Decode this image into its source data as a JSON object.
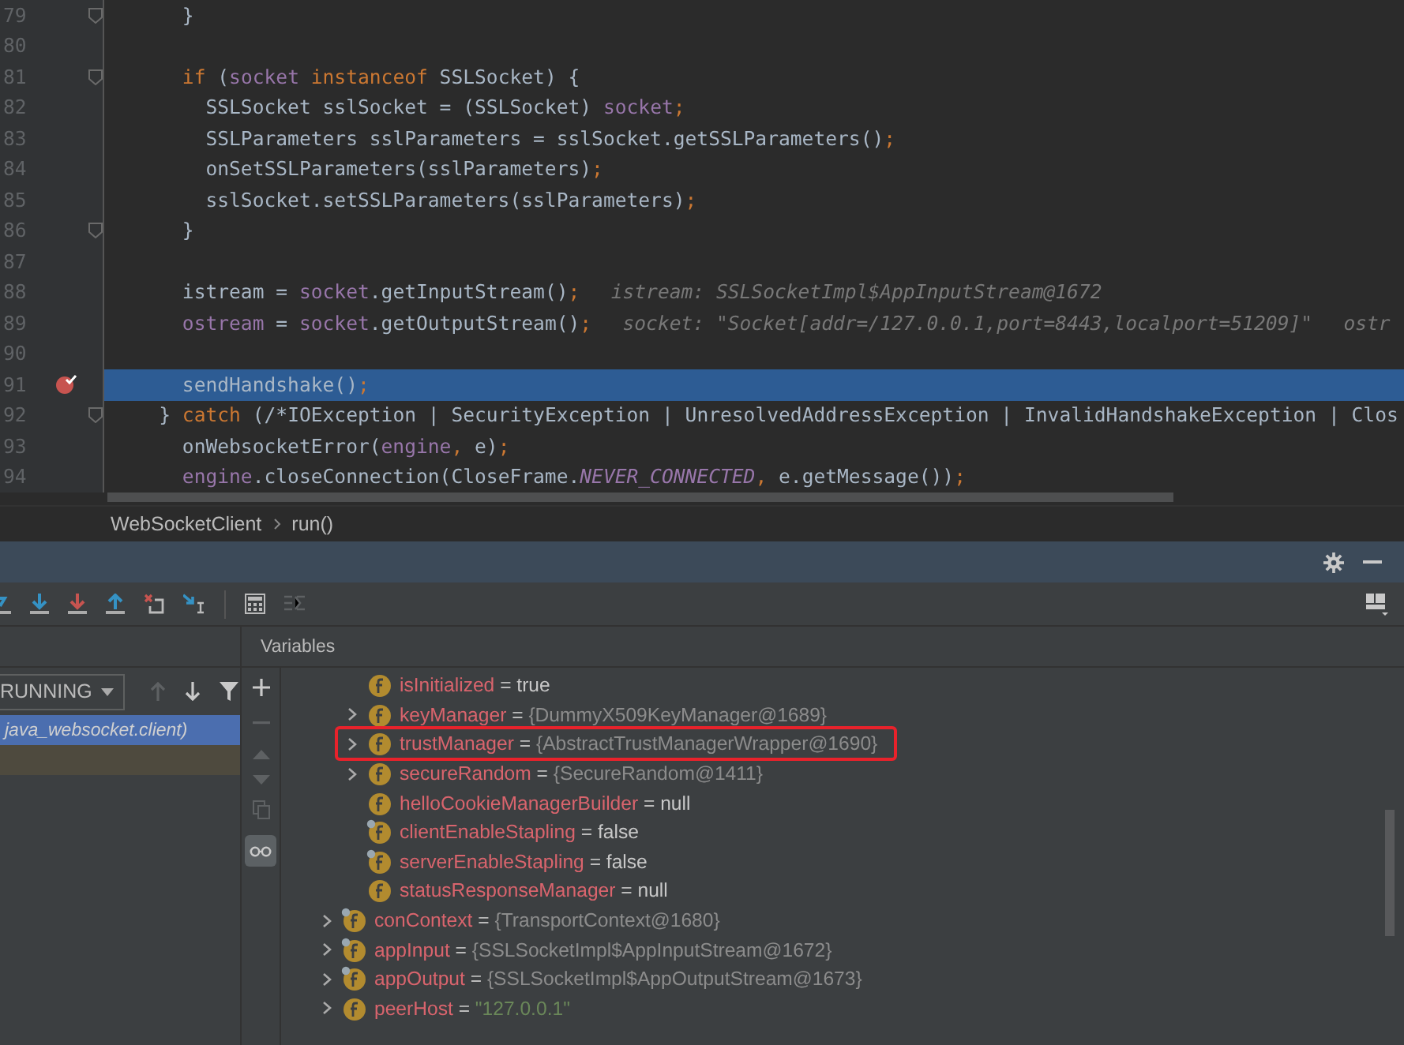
{
  "editor": {
    "lines": [
      {
        "number": "79",
        "fold": true,
        "breakpoint": false,
        "current": false,
        "segments": [
          {
            "kind": "plain",
            "text": "      }"
          }
        ]
      },
      {
        "number": "80",
        "fold": false,
        "breakpoint": false,
        "current": false
      },
      {
        "number": "81",
        "fold": true,
        "breakpoint": false,
        "current": false,
        "segments": [
          {
            "kind": "keyword",
            "text": "      if"
          },
          {
            "kind": "plain",
            "text": " ("
          },
          {
            "kind": "field",
            "text": "socket"
          },
          {
            "kind": "keyword",
            "text": " instanceof"
          },
          {
            "kind": "plain",
            "text": " SSLSocket) {"
          }
        ]
      },
      {
        "number": "82",
        "fold": false,
        "breakpoint": false,
        "current": false,
        "segments": [
          {
            "kind": "plain",
            "text": "        SSLSocket sslSocket = (SSLSocket) "
          },
          {
            "kind": "field",
            "text": "socket"
          },
          {
            "kind": "keyword",
            "text": ";"
          }
        ]
      },
      {
        "number": "83",
        "fold": false,
        "breakpoint": false,
        "current": false,
        "segments": [
          {
            "kind": "plain",
            "text": "        SSLParameters sslParameters = sslSocket.getSSLParameters()"
          },
          {
            "kind": "keyword",
            "text": ";"
          }
        ]
      },
      {
        "number": "84",
        "fold": false,
        "breakpoint": false,
        "current": false,
        "segments": [
          {
            "kind": "plain",
            "text": "        onSetSSLParameters(sslParameters)"
          },
          {
            "kind": "keyword",
            "text": ";"
          }
        ]
      },
      {
        "number": "85",
        "fold": false,
        "breakpoint": false,
        "current": false,
        "segments": [
          {
            "kind": "plain",
            "text": "        sslSocket.setSSLParameters(sslParameters)"
          },
          {
            "kind": "keyword",
            "text": ";"
          }
        ]
      },
      {
        "number": "86",
        "fold": true,
        "breakpoint": false,
        "current": false,
        "segments": [
          {
            "kind": "plain",
            "text": "      }"
          }
        ]
      },
      {
        "number": "87",
        "fold": false,
        "breakpoint": false,
        "current": false
      },
      {
        "number": "88",
        "fold": false,
        "breakpoint": false,
        "current": false,
        "segments": [
          {
            "kind": "plain",
            "text": "      istream = "
          },
          {
            "kind": "field",
            "text": "socket"
          },
          {
            "kind": "plain",
            "text": ".getInputStream()"
          },
          {
            "kind": "keyword",
            "text": ";"
          },
          {
            "kind": "hint",
            "text": "istream: SSLSocketImpl$AppInputStream@1672"
          }
        ]
      },
      {
        "number": "89",
        "fold": false,
        "breakpoint": false,
        "current": false,
        "segments": [
          {
            "kind": "field",
            "text": "      ostream"
          },
          {
            "kind": "plain",
            "text": " = "
          },
          {
            "kind": "field",
            "text": "socket"
          },
          {
            "kind": "plain",
            "text": ".getOutputStream()"
          },
          {
            "kind": "keyword",
            "text": ";"
          },
          {
            "kind": "hint",
            "text": "socket: \"Socket[addr=/127.0.0.1,port=8443,localport=51209]\""
          },
          {
            "kind": "hint",
            "text": "ostr"
          }
        ]
      },
      {
        "number": "90",
        "fold": false,
        "breakpoint": false,
        "current": false
      },
      {
        "number": "91",
        "fold": false,
        "breakpoint": true,
        "current": true,
        "segments": [
          {
            "kind": "plain",
            "text": "      sendHandshake()"
          },
          {
            "kind": "keyword",
            "text": ";"
          }
        ]
      },
      {
        "number": "92",
        "fold": true,
        "breakpoint": false,
        "current": false,
        "segments": [
          {
            "kind": "plain",
            "text": "    } "
          },
          {
            "kind": "keyword",
            "text": "catch"
          },
          {
            "kind": "plain",
            "text": " ("
          },
          {
            "kind": "comment",
            "text": "/*IOException | SecurityException | UnresolvedAddressException | InvalidHandshakeException | Clos"
          }
        ]
      },
      {
        "number": "93",
        "fold": false,
        "breakpoint": false,
        "current": false,
        "segments": [
          {
            "kind": "plain",
            "text": "      onWebsocketError("
          },
          {
            "kind": "field",
            "text": "engine"
          },
          {
            "kind": "keyword",
            "text": ","
          },
          {
            "kind": "plain",
            "text": " e)"
          },
          {
            "kind": "keyword",
            "text": ";"
          }
        ]
      },
      {
        "number": "94",
        "fold": false,
        "breakpoint": false,
        "current": false,
        "segments": [
          {
            "kind": "field",
            "text": "      engine"
          },
          {
            "kind": "plain",
            "text": ".closeConnection(CloseFrame."
          },
          {
            "kind": "constant",
            "text": "NEVER_CONNECTED"
          },
          {
            "kind": "keyword",
            "text": ","
          },
          {
            "kind": "plain",
            "text": " e.getMessage())"
          },
          {
            "kind": "keyword",
            "text": ";"
          }
        ]
      }
    ]
  },
  "breadcrumbs": [
    "WebSocketClient",
    "run()"
  ],
  "frames": {
    "filter": "RUNNING",
    "items": [
      {
        "label": "java_websocket.client)",
        "selected": true
      },
      {
        "selected": false
      }
    ]
  },
  "variables": {
    "title": "Variables",
    "items": [
      {
        "children": [
          {
            "name": "isInitialized",
            "operator": "=",
            "value": "true",
            "kind": "literal",
            "expandable": false,
            "overlay": false,
            "highlighted": false
          },
          {
            "name": "keyManager",
            "operator": "=",
            "value": "{DummyX509KeyManager@1689}",
            "kind": "object",
            "expandable": true,
            "overlay": false,
            "highlighted": false
          },
          {
            "name": "trustManager",
            "operator": "=",
            "value": "{AbstractTrustManagerWrapper@1690}",
            "kind": "object",
            "expandable": true,
            "overlay": false,
            "highlighted": true
          },
          {
            "name": "secureRandom",
            "operator": "=",
            "value": "{SecureRandom@1411}",
            "kind": "object",
            "expandable": true,
            "overlay": false,
            "highlighted": false
          },
          {
            "name": "helloCookieManagerBuilder",
            "operator": "=",
            "value": "null",
            "kind": "literal",
            "expandable": false,
            "overlay": false,
            "highlighted": false
          },
          {
            "name": "clientEnableStapling",
            "operator": "=",
            "value": "false",
            "kind": "literal",
            "expandable": false,
            "overlay": true,
            "highlighted": false
          },
          {
            "name": "serverEnableStapling",
            "operator": "=",
            "value": "false",
            "kind": "literal",
            "expandable": false,
            "overlay": true,
            "highlighted": false
          },
          {
            "name": "statusResponseManager",
            "operator": "=",
            "value": "null",
            "kind": "literal",
            "expandable": false,
            "overlay": false,
            "highlighted": false
          }
        ]
      },
      {
        "name": "conContext",
        "operator": "=",
        "value": "{TransportContext@1680}",
        "kind": "object",
        "expandable": true,
        "overlay": true,
        "highlighted": false
      },
      {
        "name": "appInput",
        "operator": "=",
        "value": "{SSLSocketImpl$AppInputStream@1672}",
        "kind": "object",
        "expandable": true,
        "overlay": true,
        "highlighted": false
      },
      {
        "name": "appOutput",
        "operator": "=",
        "value": "{SSLSocketImpl$AppOutputStream@1673}",
        "kind": "object",
        "expandable": true,
        "overlay": true,
        "highlighted": false
      },
      {
        "name": "peerHost",
        "operator": "=",
        "value": "\"127.0.0.1\"",
        "kind": "string",
        "expandable": true,
        "overlay": false,
        "highlighted": false
      }
    ]
  },
  "watch_toggle": {
    "on": true
  }
}
